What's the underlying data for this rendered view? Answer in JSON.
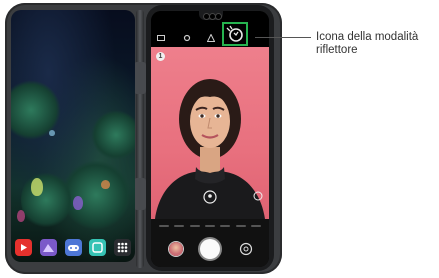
{
  "callout": {
    "label": "Icona della modalità riflettore"
  },
  "camera": {
    "indicator_number": "1",
    "mode_icon": "flash-jump-cut-icon",
    "top_icons": [
      "settings-icon",
      "gear-icon",
      "warning-icon",
      "lighting-mode-icon"
    ],
    "highlight_color": "#26b34f"
  },
  "dock": {
    "apps": [
      {
        "name": "youtube-app-icon",
        "color": "#e5312d"
      },
      {
        "name": "gallery-app-icon",
        "color": "#7b59c9"
      },
      {
        "name": "game-app-icon",
        "color": "#4e77d6"
      },
      {
        "name": "qlens-app-icon",
        "color": "#36c3b4"
      },
      {
        "name": "apps-grid-icon",
        "color": "#2b2d31"
      }
    ]
  }
}
